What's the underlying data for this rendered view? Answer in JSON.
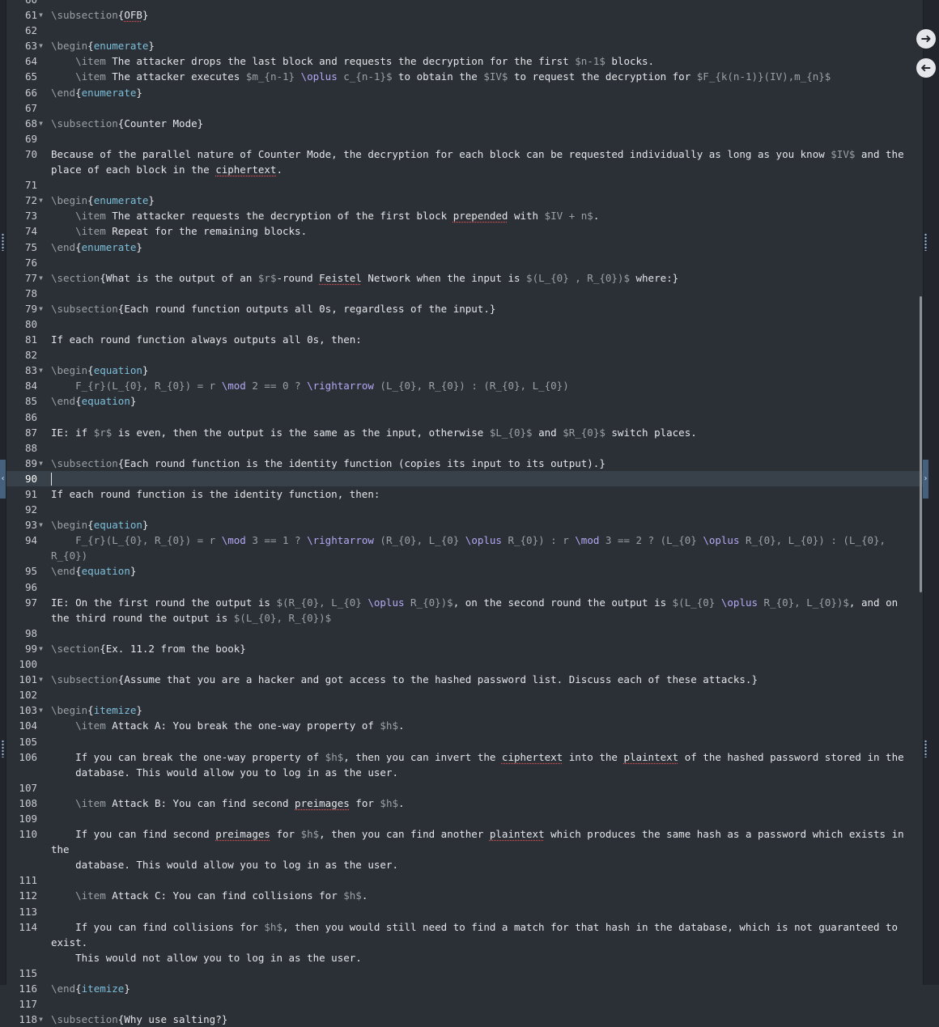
{
  "navigation": {
    "forward_icon": "arrow-right-icon",
    "back_icon": "arrow-left-icon"
  },
  "colors": {
    "background": "#2b3037",
    "text": "#e4e6e9",
    "command": "#9aa0a6",
    "environment": "#7dbfda",
    "math_command": "#b5a8f4",
    "current_line": "#384049",
    "spell_underline": "#e05252"
  },
  "editor": {
    "active_line": 90,
    "lines": [
      {
        "n": 60,
        "fold": false,
        "segs": []
      },
      {
        "n": 61,
        "fold": true,
        "segs": [
          [
            "cmd",
            "\\subsection"
          ],
          [
            "txt",
            "{"
          ],
          [
            "spell",
            "OFB"
          ],
          [
            "txt",
            "}"
          ]
        ]
      },
      {
        "n": 62,
        "fold": false,
        "segs": []
      },
      {
        "n": 63,
        "fold": true,
        "segs": [
          [
            "cmd",
            "\\begin"
          ],
          [
            "txt",
            "{"
          ],
          [
            "kw",
            "enumerate"
          ],
          [
            "txt",
            "}"
          ]
        ]
      },
      {
        "n": 64,
        "fold": false,
        "segs": [
          [
            "txt",
            "    "
          ],
          [
            "cmd",
            "\\item"
          ],
          [
            "txt",
            " The attacker drops the last block and requests the decryption for the first "
          ],
          [
            "math",
            "$n-1$"
          ],
          [
            "txt",
            " blocks."
          ]
        ]
      },
      {
        "n": 65,
        "fold": false,
        "segs": [
          [
            "txt",
            "    "
          ],
          [
            "cmd",
            "\\item"
          ],
          [
            "txt",
            " The attacker executes "
          ],
          [
            "math",
            "$m_{n-1} "
          ],
          [
            "mcmd",
            "\\oplus"
          ],
          [
            "math",
            " c_{n-1}$"
          ],
          [
            "txt",
            " to obtain the "
          ],
          [
            "math",
            "$IV$"
          ],
          [
            "txt",
            " to request the decryption for "
          ],
          [
            "math",
            "$F_{k(n-1)}(IV),m_{n}$"
          ]
        ]
      },
      {
        "n": 66,
        "fold": false,
        "segs": [
          [
            "cmd",
            "\\end"
          ],
          [
            "txt",
            "{"
          ],
          [
            "kw",
            "enumerate"
          ],
          [
            "txt",
            "}"
          ]
        ]
      },
      {
        "n": 67,
        "fold": false,
        "segs": []
      },
      {
        "n": 68,
        "fold": true,
        "segs": [
          [
            "cmd",
            "\\subsection"
          ],
          [
            "txt",
            "{Counter Mode}"
          ]
        ]
      },
      {
        "n": 69,
        "fold": false,
        "segs": []
      },
      {
        "n": 70,
        "fold": false,
        "segs": [
          [
            "txt",
            "Because of the parallel nature of Counter Mode, the decryption for each block can be requested individually as long as you know "
          ],
          [
            "math",
            "$IV$"
          ],
          [
            "txt",
            " and the place of each block in the "
          ],
          [
            "spell",
            "ciphertext"
          ],
          [
            "txt",
            "."
          ]
        ]
      },
      {
        "n": 71,
        "fold": false,
        "segs": []
      },
      {
        "n": 72,
        "fold": true,
        "segs": [
          [
            "cmd",
            "\\begin"
          ],
          [
            "txt",
            "{"
          ],
          [
            "kw",
            "enumerate"
          ],
          [
            "txt",
            "}"
          ]
        ]
      },
      {
        "n": 73,
        "fold": false,
        "segs": [
          [
            "txt",
            "    "
          ],
          [
            "cmd",
            "\\item"
          ],
          [
            "txt",
            " The attacker requests the decryption of the first block "
          ],
          [
            "spell",
            "prepended"
          ],
          [
            "txt",
            " with "
          ],
          [
            "math",
            "$IV + n$"
          ],
          [
            "txt",
            "."
          ]
        ]
      },
      {
        "n": 74,
        "fold": false,
        "segs": [
          [
            "txt",
            "    "
          ],
          [
            "cmd",
            "\\item"
          ],
          [
            "txt",
            " Repeat for the remaining blocks."
          ]
        ]
      },
      {
        "n": 75,
        "fold": false,
        "segs": [
          [
            "cmd",
            "\\end"
          ],
          [
            "txt",
            "{"
          ],
          [
            "kw",
            "enumerate"
          ],
          [
            "txt",
            "}"
          ]
        ]
      },
      {
        "n": 76,
        "fold": false,
        "segs": []
      },
      {
        "n": 77,
        "fold": true,
        "segs": [
          [
            "cmd",
            "\\section"
          ],
          [
            "txt",
            "{What is the output of an "
          ],
          [
            "math",
            "$r$"
          ],
          [
            "txt",
            "-round "
          ],
          [
            "spell",
            "Feistel"
          ],
          [
            "txt",
            " Network when the input is "
          ],
          [
            "math",
            "$(L_{0} , R_{0})$"
          ],
          [
            "txt",
            " where:}"
          ]
        ]
      },
      {
        "n": 78,
        "fold": false,
        "segs": []
      },
      {
        "n": 79,
        "fold": true,
        "segs": [
          [
            "cmd",
            "\\subsection"
          ],
          [
            "txt",
            "{Each round function outputs all 0s, regardless of the input.}"
          ]
        ]
      },
      {
        "n": 80,
        "fold": false,
        "segs": []
      },
      {
        "n": 81,
        "fold": false,
        "segs": [
          [
            "txt",
            "If each round function always outputs all 0s, then:"
          ]
        ]
      },
      {
        "n": 82,
        "fold": false,
        "segs": []
      },
      {
        "n": 83,
        "fold": true,
        "segs": [
          [
            "cmd",
            "\\begin"
          ],
          [
            "txt",
            "{"
          ],
          [
            "kw",
            "equation"
          ],
          [
            "txt",
            "}"
          ]
        ]
      },
      {
        "n": 84,
        "fold": false,
        "segs": [
          [
            "txt",
            "    "
          ],
          [
            "math",
            "F_{r}(L_{0}, R_{0}) = r "
          ],
          [
            "mcmd",
            "\\mod"
          ],
          [
            "math",
            " 2 == 0 ? "
          ],
          [
            "mcmd",
            "\\rightarrow"
          ],
          [
            "math",
            " (L_{0}, R_{0}) : (R_{0}, L_{0})"
          ]
        ]
      },
      {
        "n": 85,
        "fold": false,
        "segs": [
          [
            "cmd",
            "\\end"
          ],
          [
            "txt",
            "{"
          ],
          [
            "kw",
            "equation"
          ],
          [
            "txt",
            "}"
          ]
        ]
      },
      {
        "n": 86,
        "fold": false,
        "segs": []
      },
      {
        "n": 87,
        "fold": false,
        "segs": [
          [
            "txt",
            "IE: if "
          ],
          [
            "math",
            "$r$"
          ],
          [
            "txt",
            " is even, then the output is the same as the input, otherwise "
          ],
          [
            "math",
            "$L_{0}$"
          ],
          [
            "txt",
            " and "
          ],
          [
            "math",
            "$R_{0}$"
          ],
          [
            "txt",
            " switch places."
          ]
        ]
      },
      {
        "n": 88,
        "fold": false,
        "segs": []
      },
      {
        "n": 89,
        "fold": true,
        "segs": [
          [
            "cmd",
            "\\subsection"
          ],
          [
            "txt",
            "{Each round function is the identity function (copies its input to its output).}"
          ]
        ]
      },
      {
        "n": 90,
        "fold": false,
        "segs": [
          [
            "caret",
            ""
          ]
        ]
      },
      {
        "n": 91,
        "fold": false,
        "segs": [
          [
            "txt",
            "If each round function is the identity function, then:"
          ]
        ]
      },
      {
        "n": 92,
        "fold": false,
        "segs": []
      },
      {
        "n": 93,
        "fold": true,
        "segs": [
          [
            "cmd",
            "\\begin"
          ],
          [
            "txt",
            "{"
          ],
          [
            "kw",
            "equation"
          ],
          [
            "txt",
            "}"
          ]
        ]
      },
      {
        "n": 94,
        "fold": false,
        "segs": [
          [
            "txt",
            "    "
          ],
          [
            "math",
            "F_{r}(L_{0}, R_{0}) = r "
          ],
          [
            "mcmd",
            "\\mod"
          ],
          [
            "math",
            " 3 == 1 ? "
          ],
          [
            "mcmd",
            "\\rightarrow"
          ],
          [
            "math",
            " (R_{0}, L_{0} "
          ],
          [
            "mcmd",
            "\\oplus"
          ],
          [
            "math",
            " R_{0}) : r "
          ],
          [
            "mcmd",
            "\\mod"
          ],
          [
            "math",
            " 3 == 2 ? (L_{0} "
          ],
          [
            "mcmd",
            "\\oplus"
          ],
          [
            "math",
            " R_{0}, L_{0}) : (L_{0}, R_{0})"
          ]
        ]
      },
      {
        "n": 95,
        "fold": false,
        "segs": [
          [
            "cmd",
            "\\end"
          ],
          [
            "txt",
            "{"
          ],
          [
            "kw",
            "equation"
          ],
          [
            "txt",
            "}"
          ]
        ]
      },
      {
        "n": 96,
        "fold": false,
        "segs": []
      },
      {
        "n": 97,
        "fold": false,
        "segs": [
          [
            "txt",
            "IE: On the first round the output is "
          ],
          [
            "math",
            "$(R_{0}, L_{0} "
          ],
          [
            "mcmd",
            "\\oplus"
          ],
          [
            "math",
            " R_{0})$"
          ],
          [
            "txt",
            ", on the second round the output is "
          ],
          [
            "math",
            "$(L_{0} "
          ],
          [
            "mcmd",
            "\\oplus"
          ],
          [
            "math",
            " R_{0}, L_{0})$"
          ],
          [
            "txt",
            ", and on the third round the output is "
          ],
          [
            "math",
            "$(L_{0}, R_{0})$"
          ]
        ]
      },
      {
        "n": 98,
        "fold": false,
        "segs": []
      },
      {
        "n": 99,
        "fold": true,
        "segs": [
          [
            "cmd",
            "\\section"
          ],
          [
            "txt",
            "{Ex. 11.2 from the book}"
          ]
        ]
      },
      {
        "n": 100,
        "fold": false,
        "segs": []
      },
      {
        "n": 101,
        "fold": true,
        "segs": [
          [
            "cmd",
            "\\subsection"
          ],
          [
            "txt",
            "{Assume that you are a hacker and got access to the hashed password list. Discuss each of these attacks.}"
          ]
        ]
      },
      {
        "n": 102,
        "fold": false,
        "segs": []
      },
      {
        "n": 103,
        "fold": true,
        "segs": [
          [
            "cmd",
            "\\begin"
          ],
          [
            "txt",
            "{"
          ],
          [
            "kw",
            "itemize"
          ],
          [
            "txt",
            "}"
          ]
        ]
      },
      {
        "n": 104,
        "fold": false,
        "segs": [
          [
            "txt",
            "    "
          ],
          [
            "cmd",
            "\\item"
          ],
          [
            "txt",
            " Attack A: You break the one-way property of "
          ],
          [
            "math",
            "$h$"
          ],
          [
            "txt",
            "."
          ]
        ]
      },
      {
        "n": 105,
        "fold": false,
        "segs": []
      },
      {
        "n": 106,
        "fold": false,
        "segs": [
          [
            "txt",
            "    If you can break the one-way property of "
          ],
          [
            "math",
            "$h$"
          ],
          [
            "txt",
            ", then you can invert the "
          ],
          [
            "spell",
            "ciphertext"
          ],
          [
            "txt",
            " into the "
          ],
          [
            "spell",
            "plaintext"
          ],
          [
            "txt",
            " of the hashed password stored in the\n    database. This would allow you to log in as the user."
          ]
        ]
      },
      {
        "n": 107,
        "fold": false,
        "segs": []
      },
      {
        "n": 108,
        "fold": false,
        "segs": [
          [
            "txt",
            "    "
          ],
          [
            "cmd",
            "\\item"
          ],
          [
            "txt",
            " Attack B: You can find second "
          ],
          [
            "spell",
            "preimages"
          ],
          [
            "txt",
            " for "
          ],
          [
            "math",
            "$h$"
          ],
          [
            "txt",
            "."
          ]
        ]
      },
      {
        "n": 109,
        "fold": false,
        "segs": []
      },
      {
        "n": 110,
        "fold": false,
        "segs": [
          [
            "txt",
            "    If you can find second "
          ],
          [
            "spell",
            "preimages"
          ],
          [
            "txt",
            " for "
          ],
          [
            "math",
            "$h$"
          ],
          [
            "txt",
            ", then you can find another "
          ],
          [
            "spell",
            "plaintext"
          ],
          [
            "txt",
            " which produces the same hash as a password which exists in the\n    database. This would allow you to log in as the user."
          ]
        ]
      },
      {
        "n": 111,
        "fold": false,
        "segs": []
      },
      {
        "n": 112,
        "fold": false,
        "segs": [
          [
            "txt",
            "    "
          ],
          [
            "cmd",
            "\\item"
          ],
          [
            "txt",
            " Attack C: You can find collisions for "
          ],
          [
            "math",
            "$h$"
          ],
          [
            "txt",
            "."
          ]
        ]
      },
      {
        "n": 113,
        "fold": false,
        "segs": []
      },
      {
        "n": 114,
        "fold": false,
        "segs": [
          [
            "txt",
            "    If you can find collisions for "
          ],
          [
            "math",
            "$h$"
          ],
          [
            "txt",
            ", then you would still need to find a match for that hash in the database, which is not guaranteed to exist.\n    This would not allow you to log in as the user."
          ]
        ]
      },
      {
        "n": 115,
        "fold": false,
        "segs": []
      },
      {
        "n": 116,
        "fold": false,
        "segs": [
          [
            "cmd",
            "\\end"
          ],
          [
            "txt",
            "{"
          ],
          [
            "kw",
            "itemize"
          ],
          [
            "txt",
            "}"
          ]
        ]
      },
      {
        "n": 117,
        "fold": false,
        "segs": []
      },
      {
        "n": 118,
        "fold": true,
        "segs": [
          [
            "cmd",
            "\\subsection"
          ],
          [
            "txt",
            "{Why use salting?}"
          ]
        ]
      }
    ]
  }
}
